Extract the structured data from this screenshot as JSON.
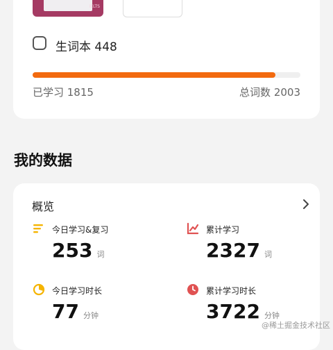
{
  "book": {
    "side_text": "IELTS"
  },
  "vocab": {
    "label": "生词本 448"
  },
  "progress": {
    "learned_label": "已学习 1815",
    "total_label": "总词数 2003",
    "fraction": 0.906
  },
  "section": {
    "title": "我的数据"
  },
  "overview": {
    "title": "概览",
    "stats": [
      {
        "label": "今日学习&复习",
        "value": "253",
        "unit": "词",
        "icon": "list-icon",
        "color": "#f5b400"
      },
      {
        "label": "累计学习",
        "value": "2327",
        "unit": "词",
        "icon": "chart-icon",
        "color": "#e05252"
      },
      {
        "label": "今日学习时长",
        "value": "77",
        "unit": "分钟",
        "icon": "clock-half-icon",
        "color": "#f5b400"
      },
      {
        "label": "累计学习时长",
        "value": "3722",
        "unit": "分钟",
        "icon": "clock-icon",
        "color": "#e05252"
      }
    ]
  },
  "watermark": "@稀土掘金技术社区",
  "colors": {
    "accent": "#f26a0f",
    "yellow": "#f5b400",
    "red": "#e05252",
    "book": "#a53a63"
  }
}
